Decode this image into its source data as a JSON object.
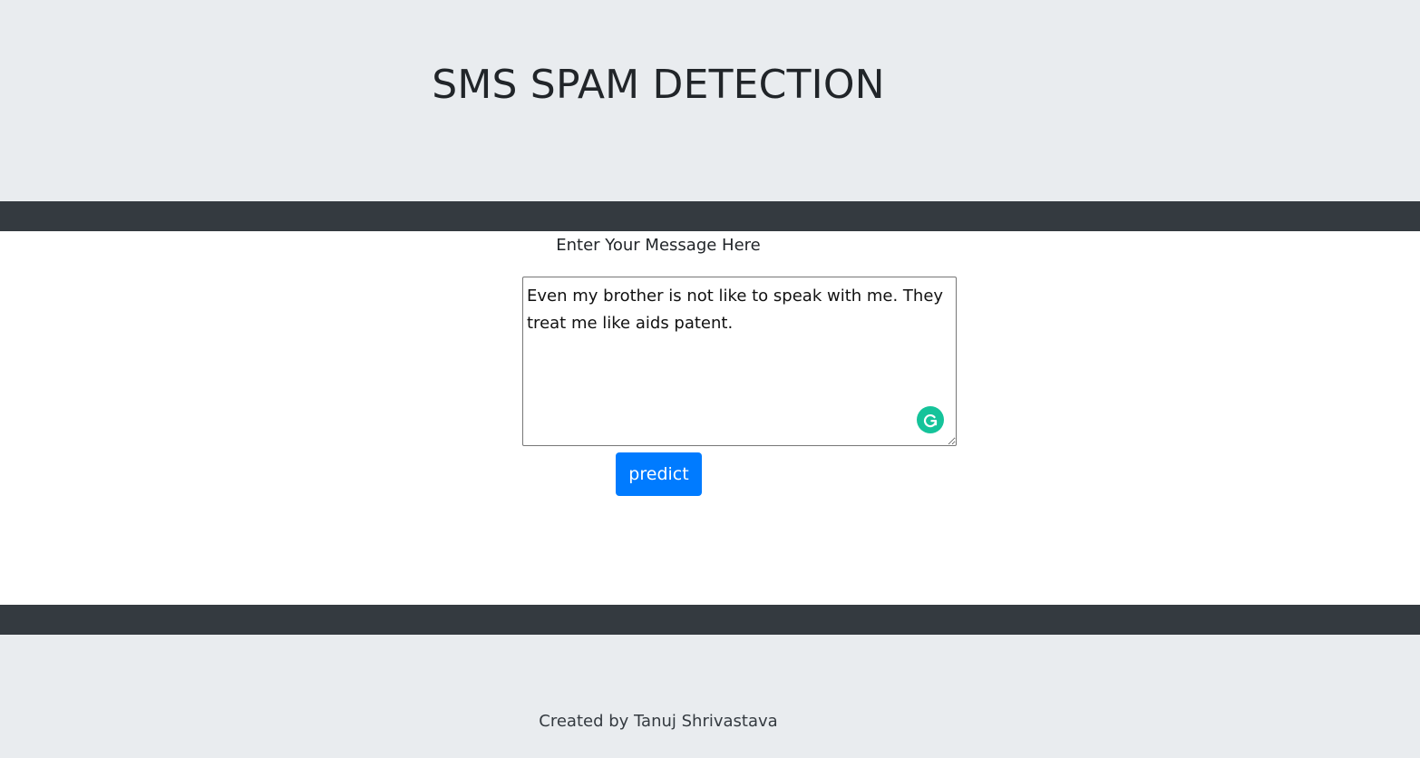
{
  "header": {
    "title": "SMS SPAM DETECTION"
  },
  "form": {
    "label": "Enter Your Message Here",
    "message_value": "Even my brother is not like to speak with me. They treat me like aids patent.",
    "predict_label": "predict",
    "grammarly_icon": "grammarly-g-icon"
  },
  "footer": {
    "credit": "Created by Tanuj Shrivastava"
  },
  "colors": {
    "header_bg": "#e9ecef",
    "divider_bar": "#343a40",
    "button_primary": "#007bff",
    "grammarly": "#15c39a"
  }
}
